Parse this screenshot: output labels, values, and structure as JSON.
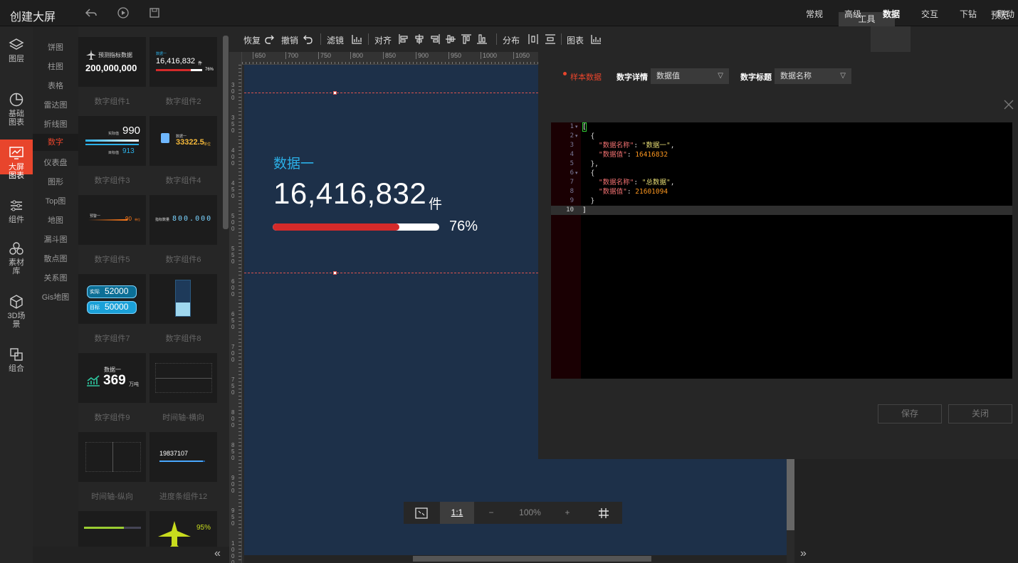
{
  "app": {
    "title": "创建大屏",
    "preview": "预览",
    "tools": "工具"
  },
  "nav": [
    {
      "label": "图层",
      "icon": "layers-icon"
    },
    {
      "label": "基础图表",
      "icon": "pie-chart-icon"
    },
    {
      "label": "大屏图表",
      "icon": "screen-chart-icon"
    },
    {
      "label": "组件",
      "icon": "sliders-icon"
    },
    {
      "label": "素材库",
      "icon": "materials-icon"
    },
    {
      "label": "3D场景",
      "icon": "cube-icon"
    },
    {
      "label": "组合",
      "icon": "group-icon"
    }
  ],
  "categories": [
    "饼图",
    "柱图",
    "表格",
    "雷达图",
    "折线图",
    "数字",
    "仪表盘",
    "图形",
    "Top图",
    "地图",
    "漏斗图",
    "散点图",
    "关系图",
    "Gis地图"
  ],
  "active_category": "数字",
  "thumbs": {
    "captions": [
      "数字组件1",
      "数字组件2",
      "数字组件3",
      "数字组件4",
      "数字组件5",
      "数字组件6",
      "数字组件7",
      "数字组件8",
      "数字组件9",
      "时间轴-横向",
      "时间轴-纵向",
      "进度条组件12"
    ],
    "t1": {
      "label": "预测指标数据",
      "value": "200,000,000"
    },
    "t2": {
      "label": "数据一",
      "value": "16,416,832",
      "unit": "件",
      "pct": "76%"
    },
    "t3": {
      "a_label": "实际值",
      "a": "990",
      "b_label": "目标值",
      "b": "913"
    },
    "t4": {
      "label": "数据一",
      "value": "33322.5",
      "unit": "单位"
    },
    "t5": {
      "label": "预警一",
      "value": "90",
      "unit": "单位"
    },
    "t6": {
      "label": "指标数量",
      "value": "800.000"
    },
    "t7": {
      "a_label": "实际",
      "a": "52000",
      "b_label": "目标",
      "b": "50000"
    },
    "t9": {
      "label": "数据一",
      "value": "369",
      "unit": "万吨"
    },
    "t12": {
      "value": "19837107",
      "pct": "95%"
    }
  },
  "toolbar": {
    "redo": "恢复",
    "undo": "撤销",
    "filter": "滤镜",
    "align": "对齐",
    "distribute": "分布",
    "chart": "图表"
  },
  "panel_tabs": [
    "常规",
    "高级",
    "数据",
    "交互",
    "下钻",
    "联动"
  ],
  "active_tab": "数据",
  "ruler_h": [
    "650",
    "700",
    "750",
    "800",
    "850",
    "900",
    "950",
    "1000",
    "1050"
  ],
  "ruler_v": [
    "300",
    "350",
    "400",
    "450",
    "500",
    "550",
    "600",
    "650",
    "700",
    "750",
    "800",
    "850",
    "900",
    "950",
    "1000"
  ],
  "widget": {
    "title": "数据一",
    "value": "16,416,832",
    "unit": "件",
    "percent": "76%",
    "progress": 0.76
  },
  "zoom": {
    "ratio": "1:1",
    "minus": "−",
    "level": "100%",
    "plus": "+"
  },
  "data_panel": {
    "sample": "样本数据",
    "detail_label": "数字详情",
    "detail_value": "数据值",
    "title_label": "数字标题",
    "title_value": "数据名称",
    "save": "保存",
    "close": "关闭"
  },
  "json_lines": [
    "1",
    "2",
    "3",
    "4",
    "5",
    "6",
    "7",
    "8",
    "9",
    "10"
  ],
  "json_records": [
    {
      "key_name": "\"数据名称\"",
      "name": "\"数据一\"",
      "key_value": "\"数据值\"",
      "value": "16416832"
    },
    {
      "key_name": "\"数据名称\"",
      "name": "\"总数据\"",
      "key_value": "\"数据值\"",
      "value": "21601094"
    }
  ],
  "colors": {
    "accent": "#e8452c",
    "stage": "#1d3049",
    "widget_title": "#2bb0e8",
    "progress": "#d42a2a"
  }
}
